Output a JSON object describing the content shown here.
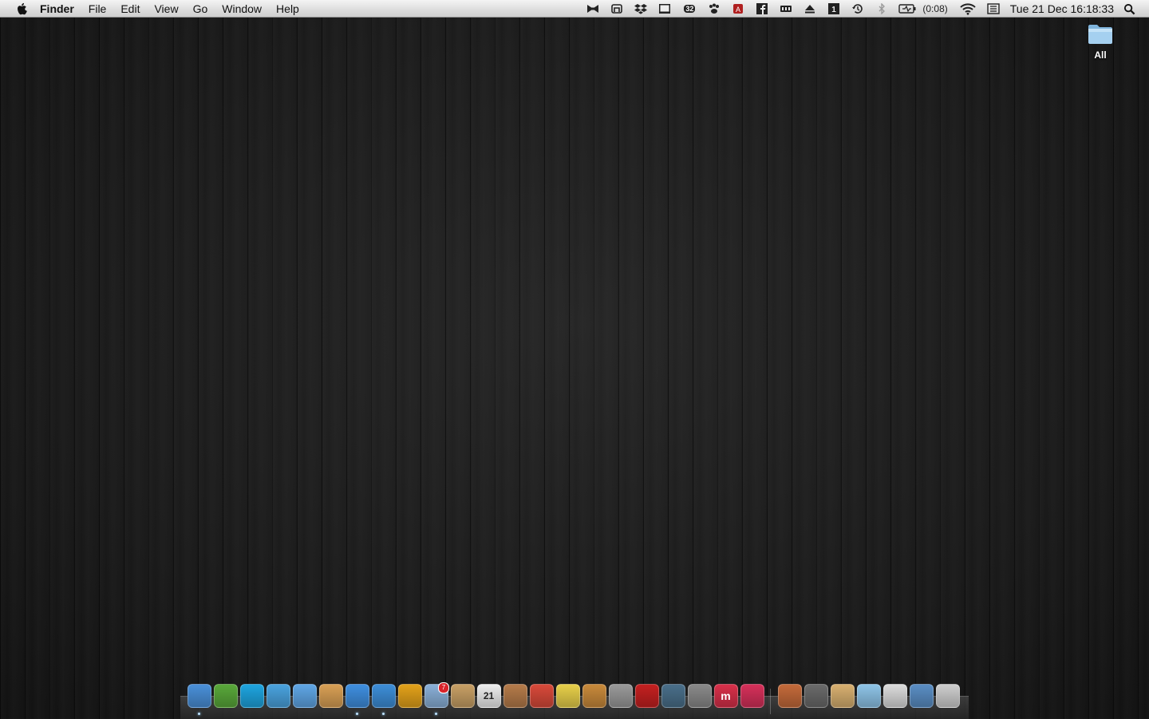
{
  "menubar": {
    "app_name": "Finder",
    "menus": [
      "File",
      "Edit",
      "View",
      "Go",
      "Window",
      "Help"
    ],
    "status_icons": [
      "bowtie-icon",
      "growl-icon",
      "dropbox-icon",
      "terminal-icon",
      "istat-temp-icon",
      "paw-icon",
      "adobe-icon",
      "facebook-icon",
      "memory-icon",
      "eject-icon",
      "text-box-icon",
      "time-machine-icon",
      "bluetooth-icon",
      "battery-icon",
      "wifi-icon",
      "input-menu-icon"
    ],
    "istat_label": "32",
    "battery_text": "(0:08)",
    "clock": "Tue 21 Dec  16:18:33"
  },
  "desktop": {
    "icons": [
      {
        "label": "All",
        "icon": "folder-icon"
      }
    ]
  },
  "dock": {
    "apps": [
      {
        "name": "finder-icon",
        "running": true,
        "color": "#4a90d9"
      },
      {
        "name": "adium-icon",
        "running": false,
        "color": "#59a83a"
      },
      {
        "name": "skype-icon",
        "running": false,
        "color": "#1ea5e0"
      },
      {
        "name": "messenger-icon",
        "running": false,
        "color": "#4aa3df"
      },
      {
        "name": "ichat-icon",
        "running": false,
        "color": "#5fa6e6"
      },
      {
        "name": "preview-icon",
        "running": false,
        "color": "#d9a055"
      },
      {
        "name": "itunes-icon",
        "running": true,
        "color": "#3f8fe0"
      },
      {
        "name": "safari-icon",
        "running": true,
        "color": "#3d8ed8"
      },
      {
        "name": "chrome-icon",
        "running": false,
        "color": "#e3a21a"
      },
      {
        "name": "mail-icon",
        "running": true,
        "color": "#8ab0d8",
        "badge": "7"
      },
      {
        "name": "address-book-icon",
        "running": false,
        "color": "#c8a065"
      },
      {
        "name": "ical-icon",
        "running": false,
        "color": "#eeeeee",
        "label": "21"
      },
      {
        "name": "home-icon",
        "running": false,
        "color": "#b57b4a"
      },
      {
        "name": "photo-booth-icon",
        "running": false,
        "color": "#d94a3a"
      },
      {
        "name": "stickies-icon",
        "running": false,
        "color": "#e8d04a"
      },
      {
        "name": "iphoto-icon",
        "running": false,
        "color": "#c98a3b"
      },
      {
        "name": "imovie-icon",
        "running": false,
        "color": "#9a9a9a"
      },
      {
        "name": "photo-book-icon",
        "running": false,
        "color": "#c42020"
      },
      {
        "name": "time-machine-icon",
        "running": false,
        "color": "#4a6f8a"
      },
      {
        "name": "system-preferences-icon",
        "running": false,
        "color": "#8a8a8a"
      },
      {
        "name": "mail-app-m-icon",
        "running": false,
        "color": "#d8304a",
        "label": "m"
      },
      {
        "name": "media-player-icon",
        "running": false,
        "color": "#d6305a"
      }
    ],
    "stacks": [
      {
        "name": "applications-stack-icon",
        "color": "#c46a3a"
      },
      {
        "name": "documents-stack-icon",
        "color": "#6a6a6a"
      },
      {
        "name": "contacts-stack-icon",
        "color": "#d8b070"
      },
      {
        "name": "folder-stack-icon",
        "color": "#8ec4e8"
      },
      {
        "name": "downloads-stack-icon",
        "color": "#dcdcdc"
      },
      {
        "name": "print-stack-icon",
        "color": "#5a8ec4"
      },
      {
        "name": "trash-icon",
        "color": "#cfcfcf"
      }
    ]
  }
}
